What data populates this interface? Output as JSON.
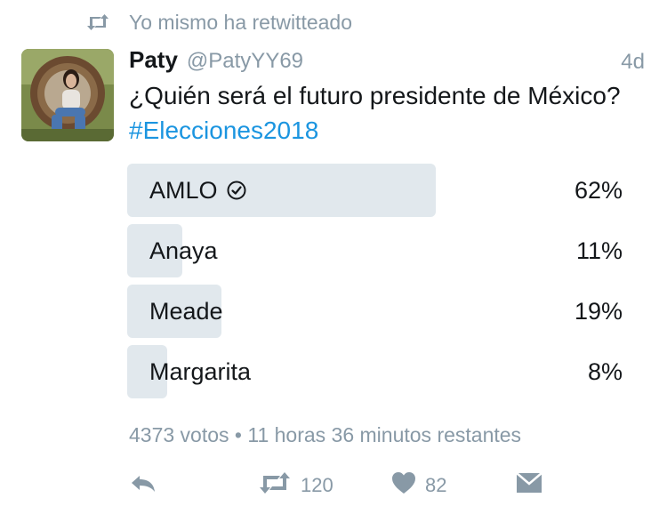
{
  "retweet_context": {
    "text": "Yo mismo ha retwitteado"
  },
  "tweet": {
    "display_name": "Paty",
    "handle": "@PatyYY69",
    "time": "4d",
    "text_main": "¿Quién será el futuro presidente de México? ",
    "hashtag": "#Elecciones2018"
  },
  "poll": {
    "options": [
      {
        "label": "AMLO",
        "percent_label": "62%",
        "fraction": 0.62,
        "selected": true
      },
      {
        "label": "Anaya",
        "percent_label": "11%",
        "fraction": 0.11,
        "selected": false
      },
      {
        "label": "Meade",
        "percent_label": "19%",
        "fraction": 0.19,
        "selected": false
      },
      {
        "label": "Margarita",
        "percent_label": "8%",
        "fraction": 0.08,
        "selected": false
      }
    ],
    "meta": "4373 votos • 11 horas 36 minutos restantes"
  },
  "actions": {
    "retweet_count": "120",
    "like_count": "82"
  },
  "colors": {
    "accent": "#1b95e0",
    "muted": "#8899a6",
    "poll_bar": "#e1e8ed",
    "text": "#14171a"
  }
}
